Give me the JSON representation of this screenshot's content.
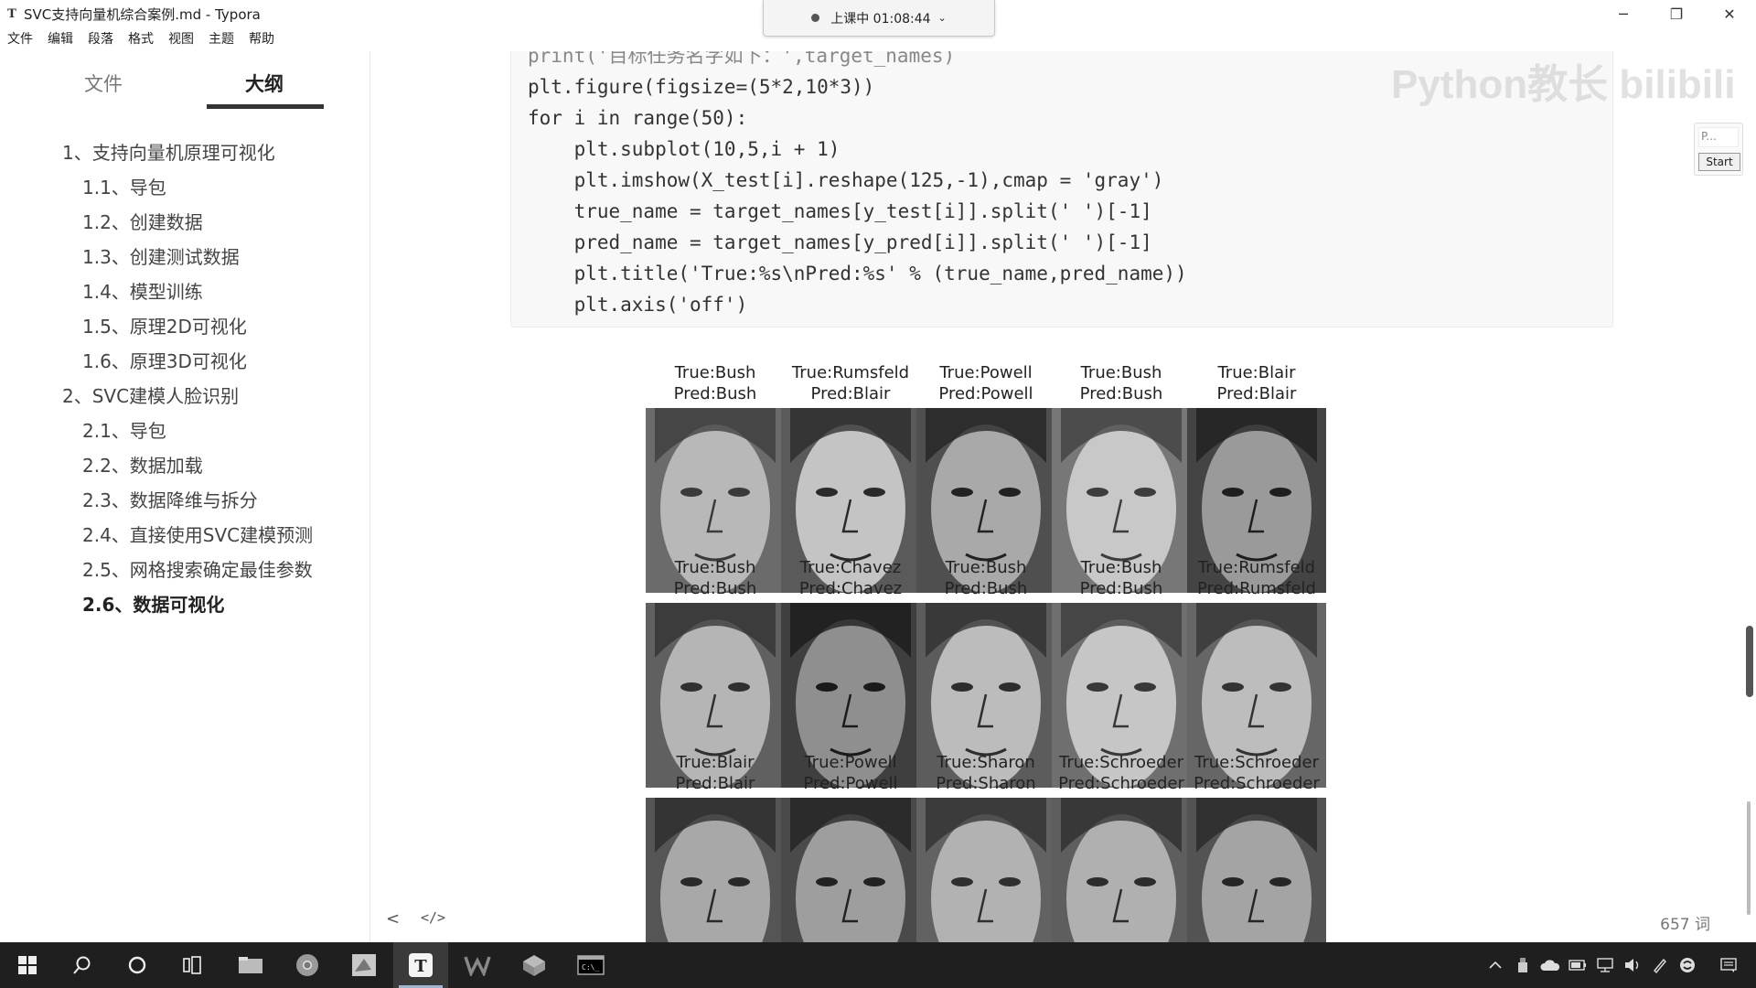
{
  "window": {
    "app_icon": "T",
    "title": "SVC支持向量机综合案例.md - Typora",
    "controls": {
      "minimize": "─",
      "maximize": "❐",
      "close": "✕"
    }
  },
  "menu": [
    "文件",
    "编辑",
    "段落",
    "格式",
    "视图",
    "主题",
    "帮助"
  ],
  "recording": {
    "label": "上课中 01:08:44",
    "chevron": "⌄"
  },
  "sidebar": {
    "tabs": {
      "files": "文件",
      "outline": "大纲"
    },
    "outline": [
      {
        "label": "1、支持向量机原理可视化",
        "level": 1,
        "active": false
      },
      {
        "label": "1.1、导包",
        "level": 2,
        "active": false
      },
      {
        "label": "1.2、创建数据",
        "level": 2,
        "active": false
      },
      {
        "label": "1.3、创建测试数据",
        "level": 2,
        "active": false
      },
      {
        "label": "1.4、模型训练",
        "level": 2,
        "active": false
      },
      {
        "label": "1.5、原理2D可视化",
        "level": 2,
        "active": false
      },
      {
        "label": "1.6、原理3D可视化",
        "level": 2,
        "active": false
      },
      {
        "label": "2、SVC建模人脸识别",
        "level": 1,
        "active": false
      },
      {
        "label": "2.1、导包",
        "level": 2,
        "active": false
      },
      {
        "label": "2.2、数据加载",
        "level": 2,
        "active": false
      },
      {
        "label": "2.3、数据降维与拆分",
        "level": 2,
        "active": false
      },
      {
        "label": "2.4、直接使用SVC建模预测",
        "level": 2,
        "active": false
      },
      {
        "label": "2.5、网格搜索确定最佳参数",
        "level": 2,
        "active": false
      },
      {
        "label": "2.6、数据可视化",
        "level": 2,
        "active": true
      }
    ]
  },
  "code": {
    "lines": [
      "print('目标任务名字如下：',target_names)",
      "plt.figure(figsize=(5*2,10*3))",
      "for i in range(50):",
      "    plt.subplot(10,5,i + 1)",
      "    plt.imshow(X_test[i].reshape(125,-1),cmap = 'gray')",
      "    true_name = target_names[y_test[i]].split(' ')[-1]",
      "    pred_name = target_names[y_pred[i]].split(' ')[-1]",
      "    plt.title('True:%s\\nPred:%s' % (true_name,pred_name))",
      "    plt.axis('off')"
    ]
  },
  "watermark": "Python教长  bilibili",
  "faces": [
    {
      "true": "True:Bush",
      "pred": "Pred:Bush"
    },
    {
      "true": "True:Rumsfeld",
      "pred": "Pred:Blair"
    },
    {
      "true": "True:Powell",
      "pred": "Pred:Powell"
    },
    {
      "true": "True:Bush",
      "pred": "Pred:Bush"
    },
    {
      "true": "True:Blair",
      "pred": "Pred:Blair"
    },
    {
      "true": "True:Bush",
      "pred": "Pred:Bush"
    },
    {
      "true": "True:Chavez",
      "pred": "Pred:Chavez"
    },
    {
      "true": "True:Bush",
      "pred": "Pred:Bush"
    },
    {
      "true": "True:Bush",
      "pred": "Pred:Bush"
    },
    {
      "true": "True:Rumsfeld",
      "pred": "Pred:Rumsfeld"
    },
    {
      "true": "True:Blair",
      "pred": "Pred:Blair"
    },
    {
      "true": "True:Powell",
      "pred": "Pred:Powell"
    },
    {
      "true": "True:Sharon",
      "pred": "Pred:Sharon"
    },
    {
      "true": "True:Schroeder",
      "pred": "Pred:Schroeder"
    },
    {
      "true": "True:Schroeder",
      "pred": "Pred:Schroeder"
    }
  ],
  "footer": {
    "back": "<",
    "source": "</>",
    "word_count": "657 词"
  },
  "side_widget": {
    "placeholder": "P...",
    "start": "Start"
  },
  "taskbar": {
    "icons": [
      "windows-start-icon",
      "search-icon",
      "cortana-icon",
      "task-view-icon",
      "file-explorer-icon",
      "chrome-icon",
      "paint-icon",
      "typora-icon",
      "wps-icon",
      "package-icon",
      "terminal-icon"
    ],
    "active_icon": "typora-icon",
    "tray": [
      "chevron-up-icon",
      "usb-icon",
      "onedrive-icon",
      "battery-icon",
      "network-icon",
      "volume-icon",
      "pen-icon",
      "sync-icon",
      "notification-icon"
    ]
  }
}
